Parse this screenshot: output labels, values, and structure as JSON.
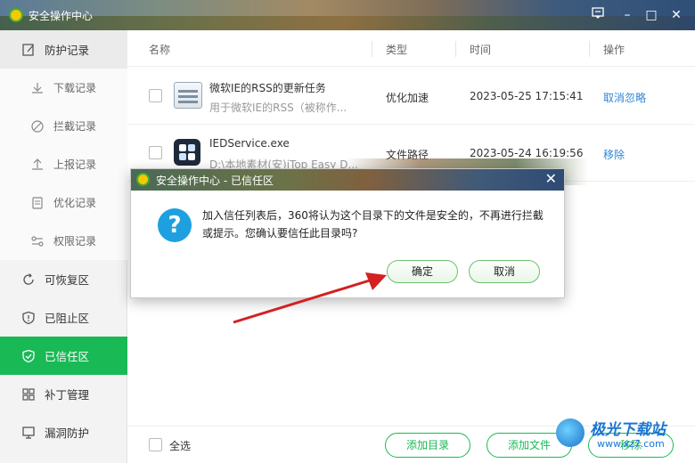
{
  "window": {
    "title": "安全操作中心",
    "controls": {
      "feedback": "feedback-icon",
      "minimize": "–",
      "maximize": "□",
      "close": "✕"
    }
  },
  "sidebar": {
    "items": [
      {
        "label": "防护记录",
        "icon": "edit-icon",
        "level": "top"
      },
      {
        "label": "下载记录",
        "icon": "download-icon",
        "level": "sub"
      },
      {
        "label": "拦截记录",
        "icon": "block-icon",
        "level": "sub"
      },
      {
        "label": "上报记录",
        "icon": "upload-icon",
        "level": "sub"
      },
      {
        "label": "优化记录",
        "icon": "document-icon",
        "level": "sub"
      },
      {
        "label": "权限记录",
        "icon": "key-icon",
        "level": "sub"
      },
      {
        "label": "可恢复区",
        "icon": "restore-icon",
        "level": "top"
      },
      {
        "label": "已阻止区",
        "icon": "shield-alert-icon",
        "level": "top"
      },
      {
        "label": "已信任区",
        "icon": "shield-check-icon",
        "level": "top",
        "active": true
      },
      {
        "label": "补丁管理",
        "icon": "grid-icon",
        "level": "top"
      },
      {
        "label": "漏洞防护",
        "icon": "monitor-icon",
        "level": "top"
      }
    ]
  },
  "table": {
    "headers": {
      "name": "名称",
      "type": "类型",
      "time": "时间",
      "action": "操作"
    },
    "rows": [
      {
        "name": "微软IE的RSS的更新任务",
        "desc": "用于微软IE的RSS（被称作...",
        "type": "优化加速",
        "time": "2023-05-25 17:15:41",
        "action": "取消忽略"
      },
      {
        "name": "IEDService.exe",
        "desc": "D:\\本地素材(安)iTop Easy D...",
        "type": "文件路径",
        "time": "2023-05-24 16:19:56",
        "action": "移除"
      }
    ]
  },
  "bottom": {
    "select_all": "全选",
    "add_dir": "添加目录",
    "add_file": "添加文件",
    "remove": "移除"
  },
  "dialog": {
    "title": "安全操作中心 - 已信任区",
    "message": "加入信任列表后，360将认为这个目录下的文件是安全的，不再进行拦截或提示。您确认要信任此目录吗?",
    "confirm": "确定",
    "cancel": "取消",
    "close": "✕"
  },
  "watermark": {
    "text": "极光下载站",
    "url": "www.xz7.com"
  },
  "colors": {
    "accent": "#19b955",
    "link": "#2f86d6",
    "arrow": "#d42020"
  }
}
